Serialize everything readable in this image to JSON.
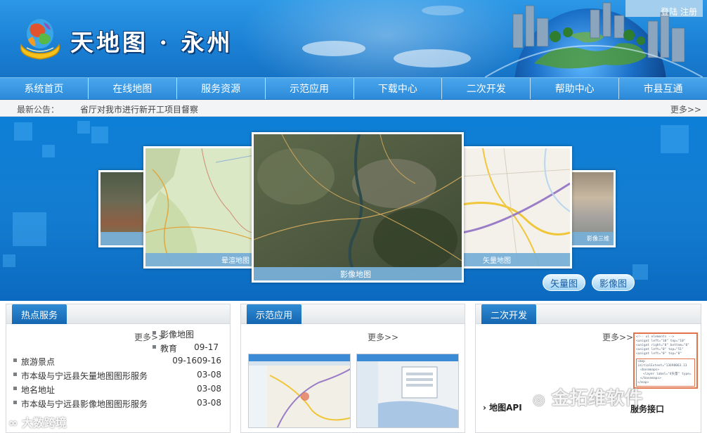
{
  "header": {
    "title": "天地图 · 永州",
    "login_label": "登陆",
    "register_label": "注册"
  },
  "nav": {
    "items": [
      {
        "label": "系统首页"
      },
      {
        "label": "在线地图"
      },
      {
        "label": "服务资源"
      },
      {
        "label": "示范应用"
      },
      {
        "label": "下载中心"
      },
      {
        "label": "二次开发"
      },
      {
        "label": "帮助中心"
      },
      {
        "label": "市县互通"
      }
    ]
  },
  "notice": {
    "label": "最新公告：",
    "text": "省厅对我市进行新开工项目督察",
    "more": "更多>>"
  },
  "carousel": {
    "cards": [
      {
        "caption": ""
      },
      {
        "caption": "晕渲地图"
      },
      {
        "caption": "影像地图"
      },
      {
        "caption": "矢量地图"
      },
      {
        "caption": "影像三维"
      }
    ],
    "buttons": {
      "vector": "矢量图",
      "imagery": "影像图"
    }
  },
  "hot_services": {
    "title": "热点服务",
    "more": "更多>>",
    "overlay": [
      {
        "title": "影像地图",
        "date": ""
      },
      {
        "title": "教育",
        "date": "09-17"
      }
    ],
    "items": [
      {
        "title": "旅游景点",
        "date": "09-1609-16"
      },
      {
        "title": "市本级与宁远县矢量地图图形服务",
        "date": "03-08"
      },
      {
        "title": "地名地址",
        "date": "03-08"
      },
      {
        "title": "市本级与宁远县影像地图图形服务",
        "date": "03-08"
      }
    ]
  },
  "demo_apps": {
    "title": "示范应用",
    "more": "更多>>"
  },
  "dev": {
    "title": "二次开发",
    "more": "更多>>",
    "api_label": "地图API",
    "service_label": "服务接口",
    "code_lines": [
      "<!-- ul elements -->",
      "<unigat left=\"10\" top=\"10\"",
      "<unigat right=\"0\" bottom=\"0\"",
      "<unigat left=\"0\" top=\"51\"",
      "<unigat left=\"0\" top=\"0\"",
      "<map initialExtent=\"13698063.13",
      "<basemaps>",
      "<layer label=\"4矢量\" type=",
      "</basemaps>",
      "</map>"
    ]
  },
  "watermarks": {
    "brand": "金拓维软件",
    "site": "大数跨境"
  },
  "colors": {
    "header_blue": "#1a7fd3",
    "nav_blue": "#3a98e3",
    "tab_blue": "#1566b1",
    "banner_blue": "#137cd0"
  }
}
